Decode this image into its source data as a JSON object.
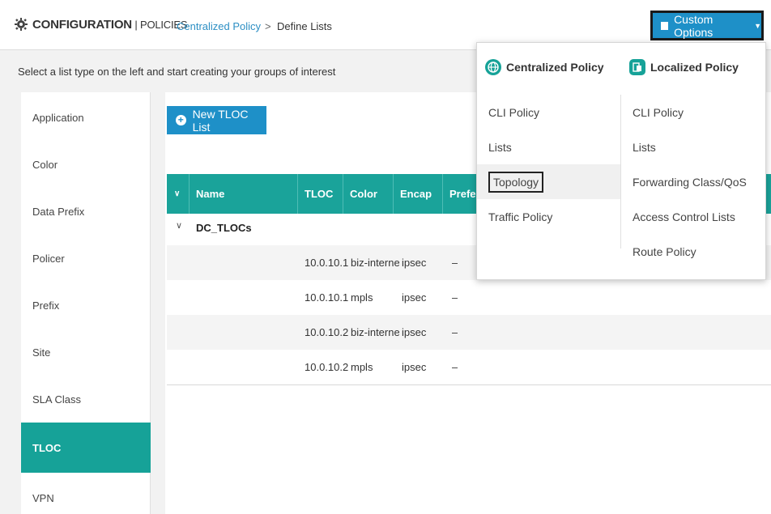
{
  "header": {
    "title_bold": "CONFIGURATION",
    "title_sep": " | ",
    "title_rest": "POLICIES",
    "breadcrumb_link": "Centralized Policy",
    "breadcrumb_sep": ">",
    "breadcrumb_current": "Define Lists",
    "custom_options_label": "Custom Options",
    "accent": "#1e90c8"
  },
  "subheader": {
    "text": "Select a list type on the left and start creating your groups of interest"
  },
  "sidebar": {
    "items": [
      {
        "label": "Application"
      },
      {
        "label": "Color"
      },
      {
        "label": "Data Prefix"
      },
      {
        "label": "Policer"
      },
      {
        "label": "Prefix"
      },
      {
        "label": "Site"
      },
      {
        "label": "SLA Class"
      },
      {
        "label": "TLOC",
        "active": true
      },
      {
        "label": "VPN"
      }
    ],
    "active_color": "#16a298"
  },
  "main": {
    "new_button_label": "New TLOC List",
    "table": {
      "headers": [
        "Name",
        "TLOC",
        "Color",
        "Encap",
        "Prefe"
      ],
      "group": "DC_TLOCs",
      "rows": [
        {
          "tloc": "10.0.10.1",
          "color": "biz-interne",
          "encap": "ipsec",
          "pref": "–"
        },
        {
          "tloc": "10.0.10.1",
          "color": "mpls",
          "encap": "ipsec",
          "pref": "–"
        },
        {
          "tloc": "10.0.10.2",
          "color": "biz-interne",
          "encap": "ipsec",
          "pref": "–"
        },
        {
          "tloc": "10.0.10.2",
          "color": "mpls",
          "encap": "ipsec",
          "pref": "–"
        }
      ]
    }
  },
  "dropdown": {
    "centralized": {
      "heading": "Centralized Policy",
      "items": [
        "CLI Policy",
        "Lists",
        "Topology",
        "Traffic Policy"
      ]
    },
    "localized": {
      "heading": "Localized Policy",
      "items": [
        "CLI Policy",
        "Lists",
        "Forwarding Class/QoS",
        "Access Control Lists",
        "Route Policy"
      ]
    }
  }
}
